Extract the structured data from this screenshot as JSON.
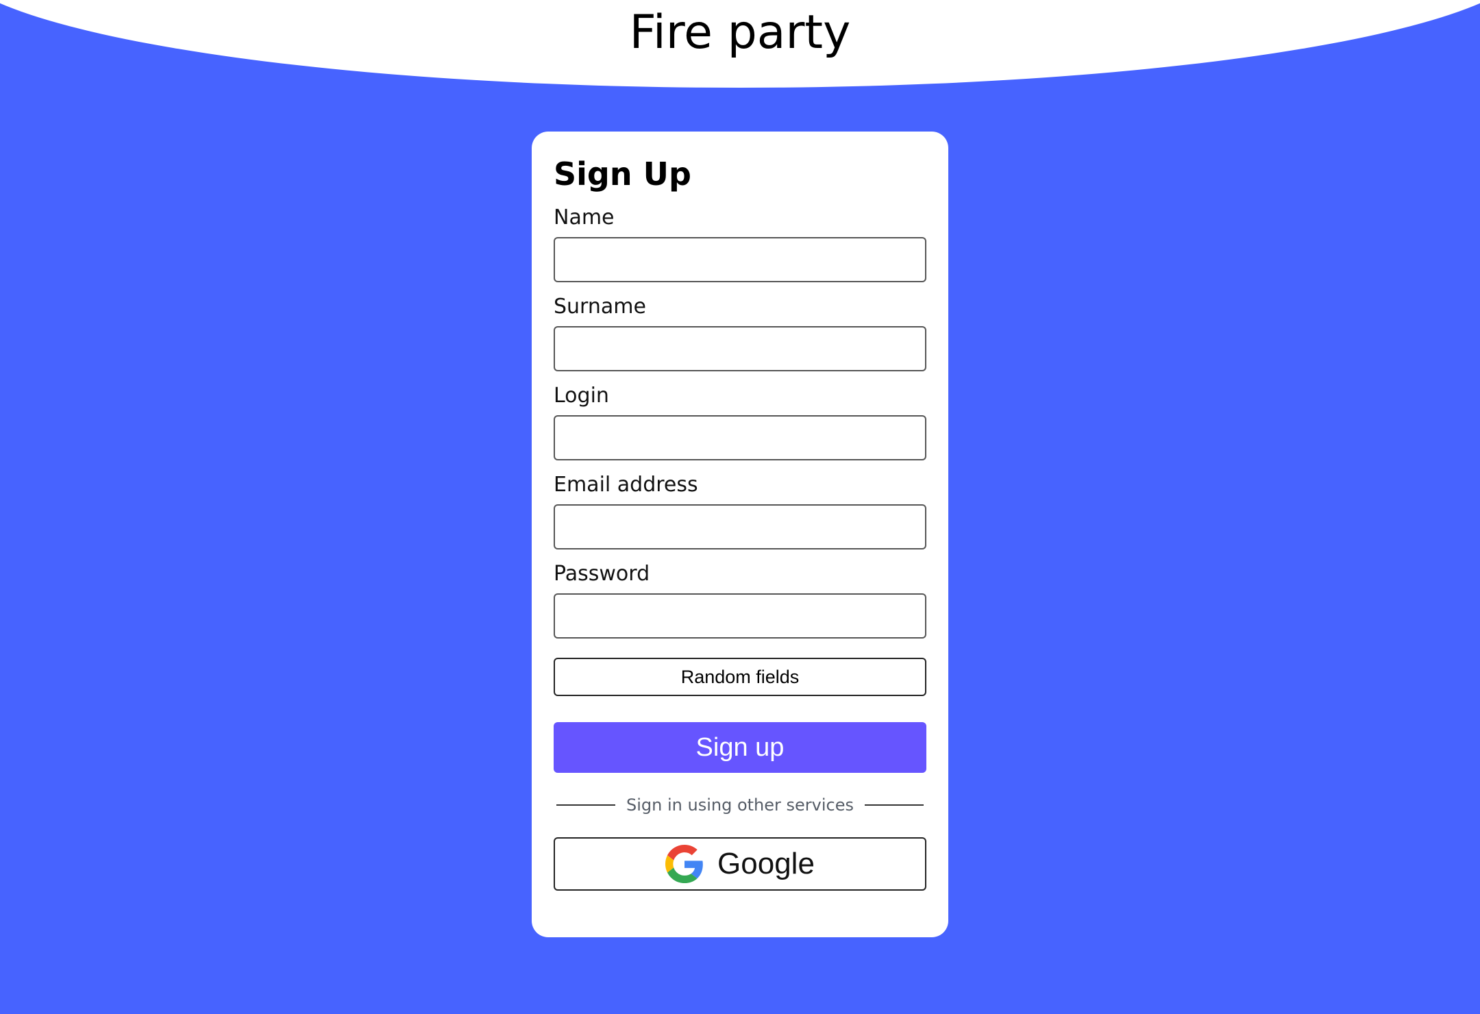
{
  "header": {
    "title": "Fire party"
  },
  "form": {
    "title": "Sign Up",
    "fields": [
      {
        "label": "Name",
        "value": "",
        "placeholder": ""
      },
      {
        "label": "Surname",
        "value": "",
        "placeholder": ""
      },
      {
        "label": "Login",
        "value": "",
        "placeholder": ""
      },
      {
        "label": "Email address",
        "value": "",
        "placeholder": ""
      },
      {
        "label": "Password",
        "value": "",
        "placeholder": ""
      }
    ],
    "random_label": "Random fields",
    "submit_label": "Sign up",
    "divider_text": "Sign in using other services",
    "google_label": "Google"
  },
  "colors": {
    "background": "#4763ff",
    "card": "#ffffff",
    "accent": "#6655ff"
  },
  "icons": {
    "google": "google-icon"
  }
}
